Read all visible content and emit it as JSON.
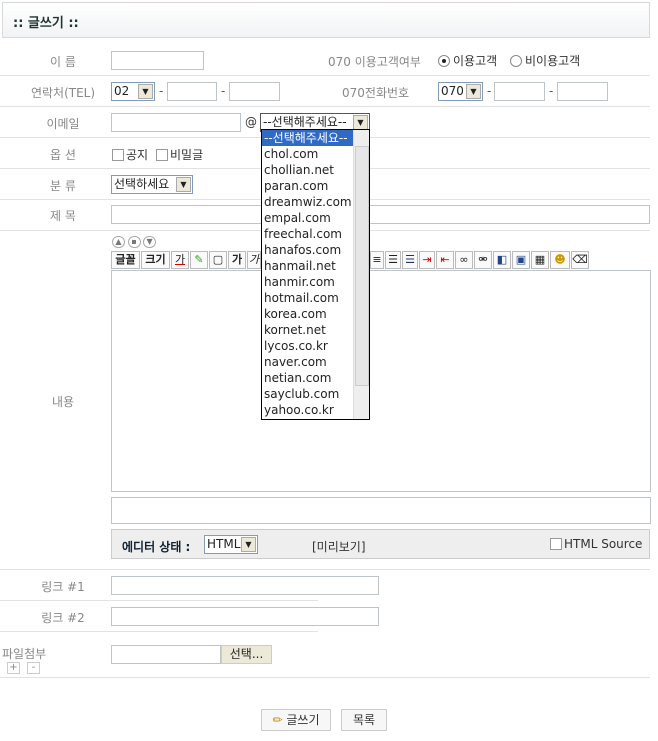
{
  "header": {
    "title": ":: 글쓰기 ::"
  },
  "labels": {
    "name": "이 름",
    "tel": "연락처(TEL)",
    "email": "이메일",
    "options": "옵 션",
    "category": "분 류",
    "subject": "제 목",
    "content": "내용",
    "link1": "링크 #1",
    "link2": "링크 #2",
    "file": "파일첨부",
    "customer_070": "070 이용고객여부",
    "phone_070": "070전화번호"
  },
  "radio": {
    "user": "이용고객",
    "nonuser": "비이용고객",
    "selected": "이용고객"
  },
  "tel": {
    "area": "02",
    "sep": "-"
  },
  "phone070": {
    "prefix": "070"
  },
  "email": {
    "at": "@",
    "domain_selected": "--선택해주세요--",
    "options": [
      "--선택해주세요--",
      "chol.com",
      "chollian.net",
      "paran.com",
      "dreamwiz.com",
      "empal.com",
      "freechal.com",
      "hanafos.com",
      "hanmail.net",
      "hanmir.com",
      "hotmail.com",
      "korea.com",
      "kornet.net",
      "lycos.co.kr",
      "naver.com",
      "netian.com",
      "sayclub.com",
      "yahoo.co.kr"
    ]
  },
  "options": {
    "notice": "공지",
    "secret": "비밀글"
  },
  "category": {
    "selected": "선택하세요"
  },
  "editor": {
    "font": "글꼴",
    "size": "크기",
    "color": "가",
    "bold": "가",
    "italic": "가",
    "status_label": "에디터 상태 :",
    "mode": "HTML",
    "preview": "[미리보기]",
    "html_source": "HTML Source"
  },
  "file": {
    "browse": "선택...",
    "add": "+",
    "remove": "-"
  },
  "buttons": {
    "write": "글쓰기",
    "list": "목록"
  }
}
